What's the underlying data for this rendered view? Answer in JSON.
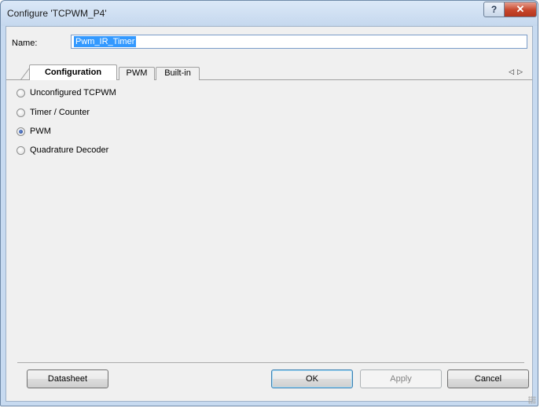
{
  "window": {
    "title": "Configure 'TCPWM_P4'",
    "help_glyph": "?",
    "close_glyph": "✕"
  },
  "name_field": {
    "label": "Name:",
    "value": "Pwm_IR_Timer"
  },
  "tabs": [
    {
      "label": "Configuration",
      "active": true
    },
    {
      "label": "PWM",
      "active": false
    },
    {
      "label": "Built-in",
      "active": false
    }
  ],
  "tab_scroll": {
    "left": "◁",
    "right": "▷"
  },
  "modes": [
    {
      "label": "Unconfigured TCPWM",
      "checked": false
    },
    {
      "label": "Timer / Counter",
      "checked": false
    },
    {
      "label": "PWM",
      "checked": true
    },
    {
      "label": "Quadrature Decoder",
      "checked": false
    }
  ],
  "buttons": {
    "datasheet": "Datasheet",
    "ok": "OK",
    "apply": "Apply",
    "cancel": "Cancel"
  },
  "colors": {
    "selection": "#3399ff",
    "close_button": "#c7462c",
    "frame": "#c7daf0"
  }
}
